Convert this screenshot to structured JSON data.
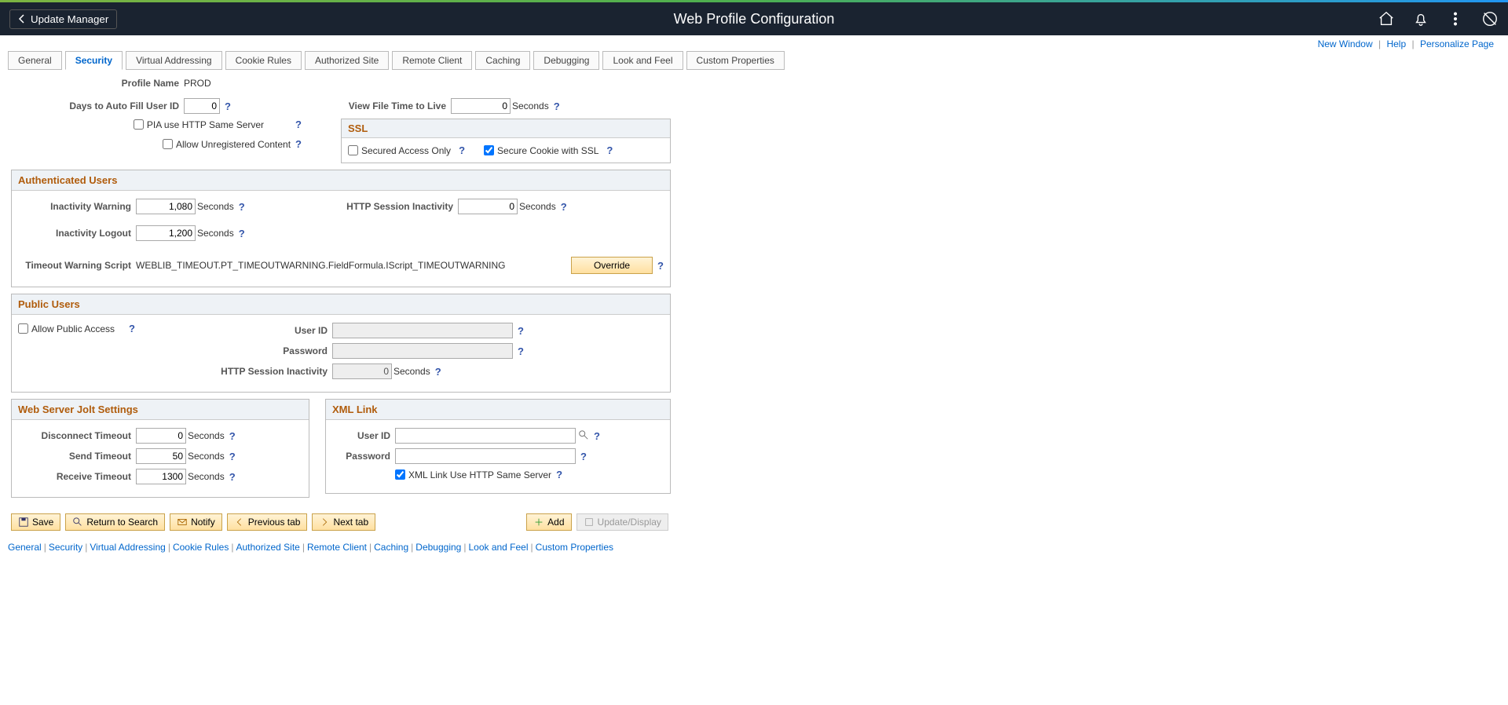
{
  "header": {
    "back_label": "Update Manager",
    "title": "Web Profile Configuration"
  },
  "toplinks": {
    "new_window": "New Window",
    "help": "Help",
    "personalize": "Personalize Page"
  },
  "tabs": [
    "General",
    "Security",
    "Virtual Addressing",
    "Cookie Rules",
    "Authorized Site",
    "Remote Client",
    "Caching",
    "Debugging",
    "Look and Feel",
    "Custom Properties"
  ],
  "active_tab_index": 1,
  "profile": {
    "label": "Profile Name",
    "value": "PROD"
  },
  "days_auto_fill": {
    "label": "Days to Auto Fill User ID",
    "value": "0"
  },
  "view_file_ttl": {
    "label": "View File Time to Live",
    "value": "0",
    "unit": "Seconds"
  },
  "pia_same_server": {
    "label": "PIA use HTTP Same Server",
    "checked": false
  },
  "allow_unreg": {
    "label": "Allow Unregistered Content",
    "checked": false
  },
  "ssl": {
    "title": "SSL",
    "secured_only": {
      "label": "Secured Access Only",
      "checked": false
    },
    "secure_cookie": {
      "label": "Secure Cookie with SSL",
      "checked": true
    }
  },
  "auth_users": {
    "title": "Authenticated Users",
    "inactivity_warning": {
      "label": "Inactivity Warning",
      "value": "1,080",
      "unit": "Seconds"
    },
    "http_session_inactivity": {
      "label": "HTTP Session Inactivity",
      "value": "0",
      "unit": "Seconds"
    },
    "inactivity_logout": {
      "label": "Inactivity Logout",
      "value": "1,200",
      "unit": "Seconds"
    },
    "timeout_script": {
      "label": "Timeout Warning Script",
      "value": "WEBLIB_TIMEOUT.PT_TIMEOUTWARNING.FieldFormula.IScript_TIMEOUTWARNING"
    },
    "override": "Override"
  },
  "public_users": {
    "title": "Public Users",
    "allow_public": {
      "label": "Allow Public Access",
      "checked": false
    },
    "user_id": {
      "label": "User ID",
      "value": ""
    },
    "password": {
      "label": "Password",
      "value": ""
    },
    "http_session_inactivity": {
      "label": "HTTP Session Inactivity",
      "value": "0",
      "unit": "Seconds"
    }
  },
  "jolt": {
    "title": "Web Server Jolt Settings",
    "disconnect": {
      "label": "Disconnect Timeout",
      "value": "0",
      "unit": "Seconds"
    },
    "send": {
      "label": "Send Timeout",
      "value": "50",
      "unit": "Seconds"
    },
    "receive": {
      "label": "Receive Timeout",
      "value": "1300",
      "unit": "Seconds"
    }
  },
  "xml_link": {
    "title": "XML Link",
    "user_id": {
      "label": "User ID",
      "value": ""
    },
    "password": {
      "label": "Password",
      "value": ""
    },
    "same_server": {
      "label": "XML Link Use HTTP Same Server",
      "checked": true
    }
  },
  "buttons": {
    "save": "Save",
    "return": "Return to Search",
    "notify": "Notify",
    "prev": "Previous tab",
    "next": "Next tab",
    "add": "Add",
    "update": "Update/Display"
  }
}
